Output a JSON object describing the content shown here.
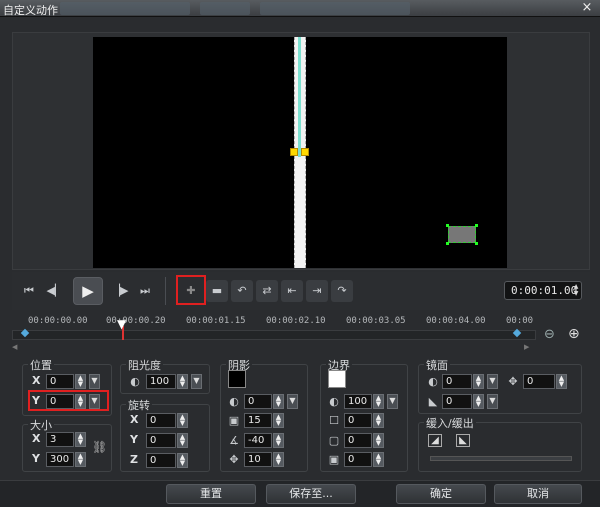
{
  "window": {
    "title": "自定义动作",
    "close_icon": "×"
  },
  "playback": {
    "timecode": "0:00:01.00",
    "buttons": [
      "go-to-start",
      "prev-frame",
      "play",
      "next-frame",
      "go-to-end"
    ]
  },
  "keyframe_tools": [
    "add-keyframe",
    "remove-keyframe",
    "reverse-path",
    "move-left",
    "swap",
    "move-right",
    "copy",
    "paste"
  ],
  "timeline": {
    "ticks": [
      "00:00:00.00",
      "00:00:00.20",
      "00:00:01.15",
      "00:00:02.10",
      "00:00:03.05",
      "00:00:04.00",
      "00:00"
    ]
  },
  "position": {
    "label": "位置",
    "x_label": "X",
    "x": "0",
    "y_label": "Y",
    "y": "0"
  },
  "size": {
    "label": "大小",
    "x_label": "X",
    "x": "3",
    "y_label": "Y",
    "y": "300"
  },
  "opacity": {
    "label": "阻光度",
    "value": "100"
  },
  "rotation": {
    "label": "旋转",
    "x_label": "X",
    "x": "0",
    "y_label": "Y",
    "y": "0",
    "z_label": "Z",
    "z": "0"
  },
  "shadow": {
    "label": "阴影",
    "color": "#000000",
    "v1": "0",
    "v2": "15",
    "v3": "-40",
    "v4": "10"
  },
  "border": {
    "label": "边界",
    "color": "#ffffff",
    "v1": "100",
    "v2": "0",
    "v3": "0",
    "v4": "0"
  },
  "mirror": {
    "label": "镜面",
    "v1": "0",
    "v2": "0",
    "v3": "0"
  },
  "fade": {
    "label": "缓入/缓出"
  },
  "footer": {
    "reset": "重置",
    "save_to": "保存至...",
    "ok": "确定",
    "cancel": "取消"
  },
  "colors": {
    "highlight": "#e02020",
    "keyframe_handle": "#ffd800"
  }
}
